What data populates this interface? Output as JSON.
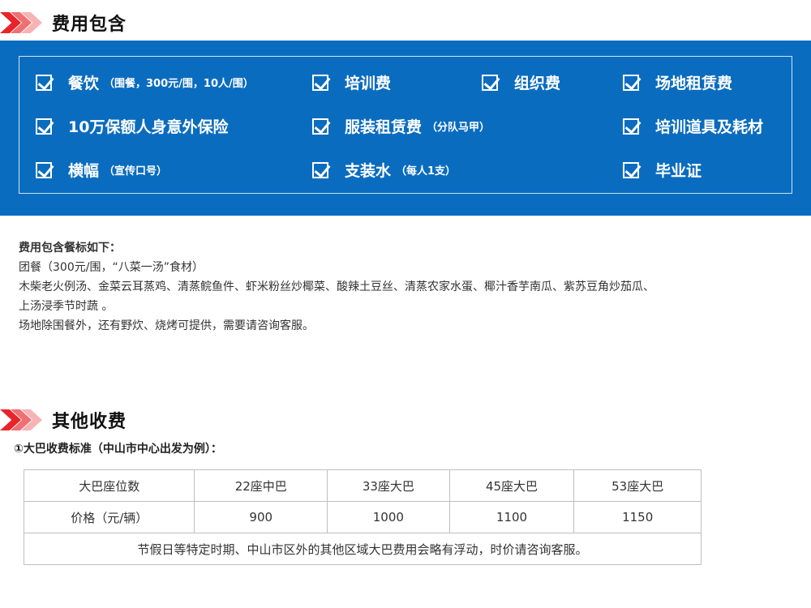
{
  "section1": {
    "title": "费用包含"
  },
  "included": [
    {
      "main": "餐饮",
      "sub": "（围餐，300元/围，10人/围）"
    },
    {
      "main": "培训费",
      "sub": ""
    },
    {
      "main": "组织费",
      "sub": ""
    },
    {
      "main": "场地租赁费",
      "sub": ""
    },
    {
      "main": "10万保额人身意外保险",
      "sub": ""
    },
    {
      "main": "服装租赁费",
      "sub": "（分队马甲）"
    },
    {
      "main": "培训道具及耗材",
      "sub": ""
    },
    {
      "main": "横幅",
      "sub": "（宣传口号）"
    },
    {
      "main": "支装水",
      "sub": "（每人1支）"
    },
    {
      "main": "毕业证",
      "sub": ""
    }
  ],
  "meal": {
    "heading": "费用包含餐标如下：",
    "line1": "团餐（300元/围，“八菜一汤”食材）",
    "line2": "木柴老火例汤、金菜云耳蒸鸡、清蒸鲩鱼件、虾米粉丝炒椰菜、酸辣土豆丝、清蒸农家水蛋、椰汁香芋南瓜、紫苏豆角炒茄瓜、",
    "line3": "上汤浸季节时蔬 。",
    "line4": "场地除围餐外，还有野炊、烧烤可提供，需要请咨询客服。"
  },
  "section2": {
    "title": "其他收费"
  },
  "bus": {
    "subtitle": "①大巴收费标准（中山市中心出发为例）：",
    "header": [
      "大巴座位数",
      "22座中巴",
      "33座大巴",
      "45座大巴",
      "53座大巴"
    ],
    "row": [
      "价格（元/辆）",
      "900",
      "1000",
      "1100",
      "1150"
    ],
    "note": "节假日等特定时期、中山市区外的其他区域大巴费用会略有浮动，时价请咨询客服。"
  },
  "colors": {
    "blue": "#0a6cbf",
    "red": "#e8242b"
  },
  "icons": {
    "section_marker": "chevron-right-icon",
    "included_marker": "checkbox-checked-icon"
  }
}
